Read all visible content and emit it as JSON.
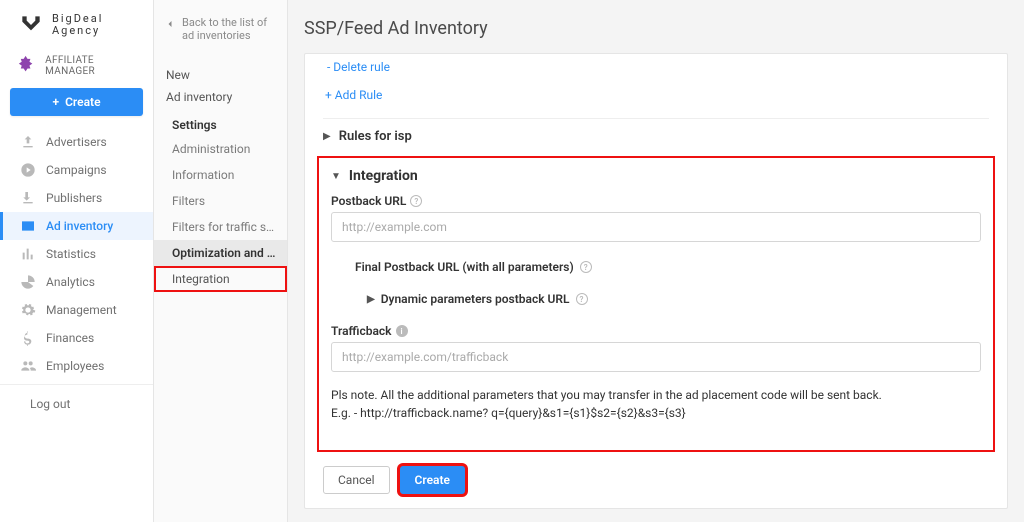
{
  "brand": {
    "line1": "BigDeal",
    "line2": "Agency"
  },
  "affiliate_label": "AFFILIATE MANAGER",
  "create_button": "Create",
  "nav": {
    "advertisers": "Advertisers",
    "campaigns": "Campaigns",
    "publishers": "Publishers",
    "ad_inventory": "Ad inventory",
    "statistics": "Statistics",
    "analytics": "Analytics",
    "management": "Management",
    "finances": "Finances",
    "employees": "Employees",
    "logout": "Log out"
  },
  "secnav": {
    "back_line1": "Back to the list of",
    "back_line2": "ad inventories",
    "new": "New",
    "ad_inventory": "Ad inventory",
    "settings": "Settings",
    "administration": "Administration",
    "information": "Information",
    "filters": "Filters",
    "filters_traffic": "Filters for traffic sour...",
    "optimization": "Optimization and rules",
    "integration": "Integration"
  },
  "page": {
    "title": "SSP/Feed Ad Inventory",
    "delete_rule": "- Delete rule",
    "add_rule": "+ Add Rule",
    "rules_for_isp": "Rules for isp",
    "integration_heading": "Integration",
    "postback_label": "Postback URL",
    "postback_placeholder": "http://example.com",
    "final_postback_label": "Final Postback URL (with all parameters)",
    "dynamic_params_label": "Dynamic parameters postback URL",
    "trafficback_label": "Trafficback",
    "trafficback_placeholder": "http://example.com/trafficback",
    "note_line1": "Pls note. All the additional parameters that you may transfer in the ad placement code will be sent back.",
    "note_line2": "E.g. - http://trafficback.name? q={query}&s1={s1}$s2={s2}&s3={s3}",
    "cancel": "Cancel",
    "create": "Create"
  }
}
